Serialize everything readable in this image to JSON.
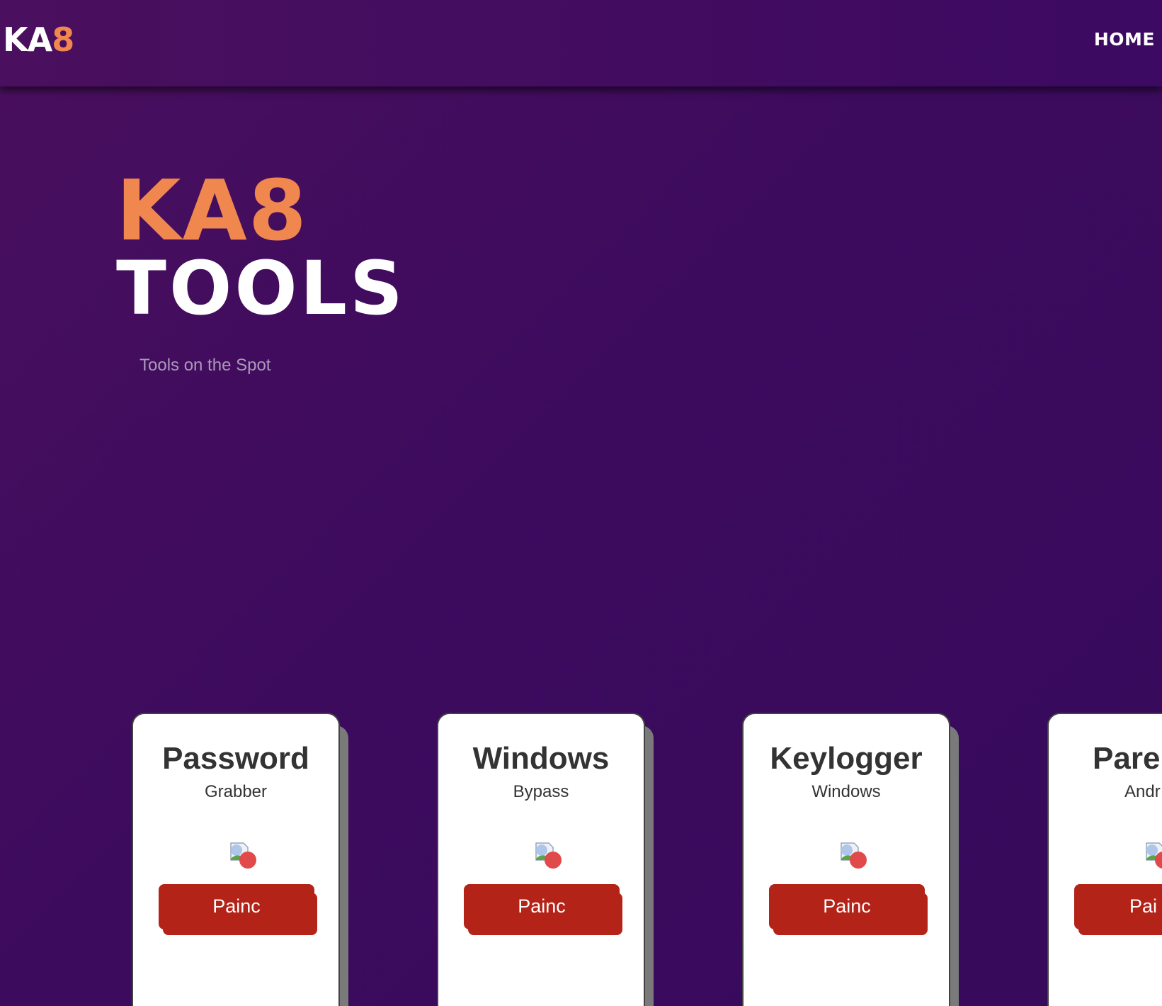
{
  "navbar": {
    "logo_ka": "KA",
    "logo_8": "8",
    "home_label": "HOME"
  },
  "hero": {
    "title_line1": "KA8",
    "title_line2": "TOOLS",
    "subtitle": "Tools on the Spot"
  },
  "cards": [
    {
      "title": "Password",
      "subtitle": "Grabber",
      "image": "broken-image-icon",
      "button_label": "Painc"
    },
    {
      "title": "Windows",
      "subtitle": "Bypass",
      "image": "broken-image-icon",
      "button_label": "Painc"
    },
    {
      "title": "Keylogger",
      "subtitle": "Windows",
      "image": "broken-image-icon",
      "button_label": "Painc"
    },
    {
      "title": "Pare",
      "subtitle": "Andr",
      "image": "broken-image-icon",
      "button_label": "Pai"
    }
  ],
  "colors": {
    "accent_orange": "#f0874f",
    "background_purple": "#3d0b5e",
    "button_red": "#b42318"
  }
}
